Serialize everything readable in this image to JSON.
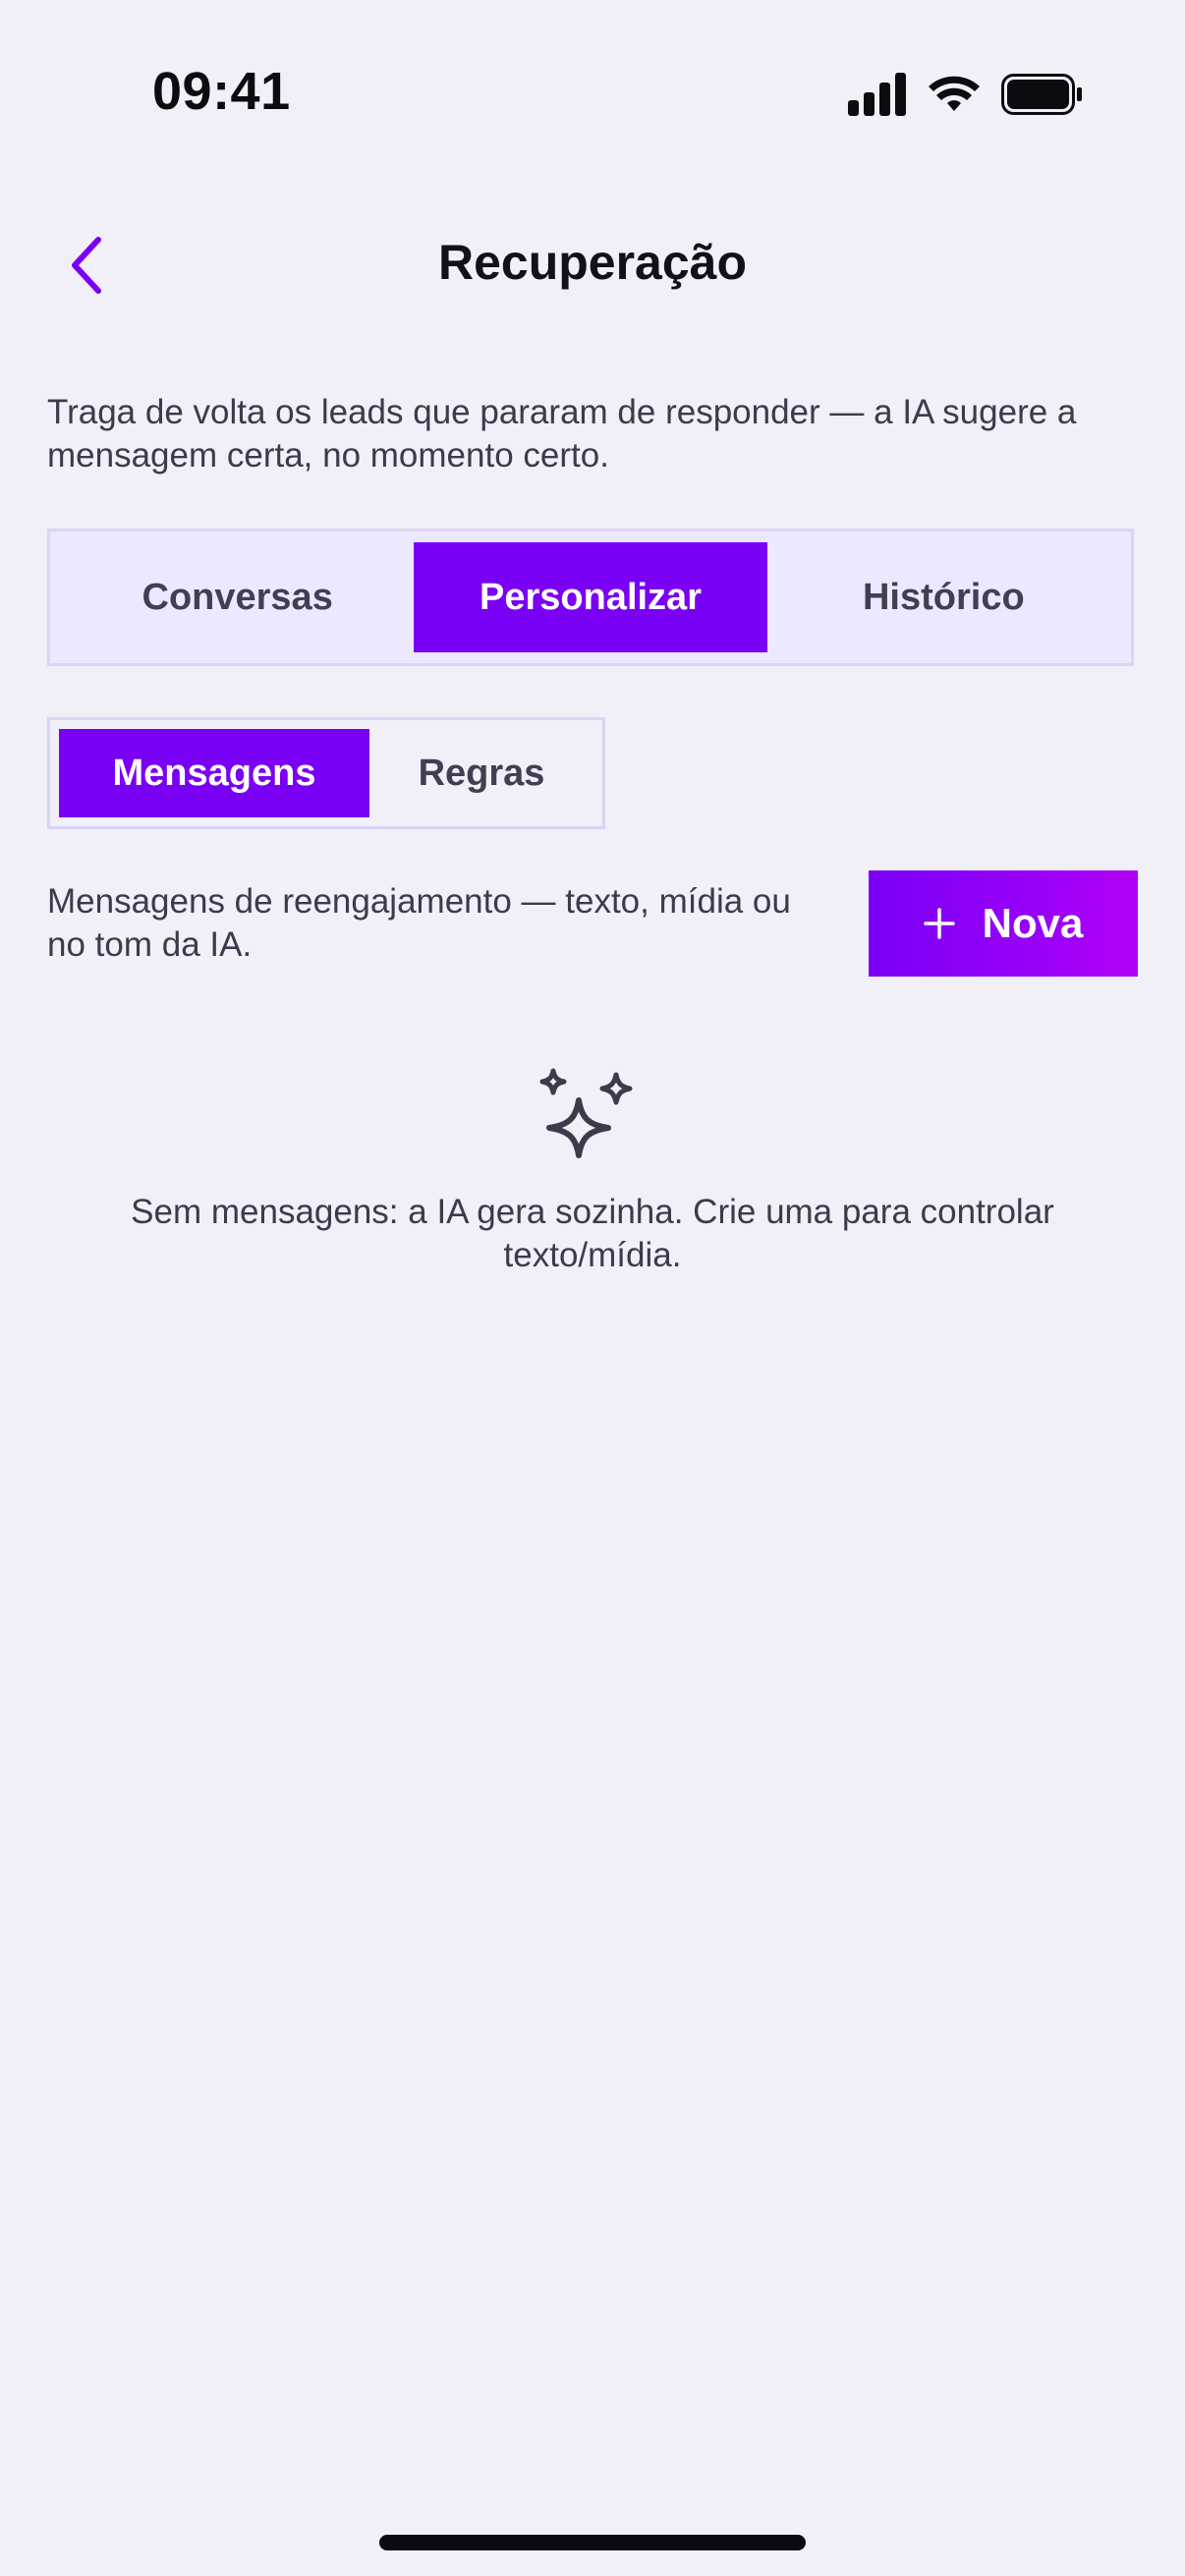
{
  "status_bar": {
    "time": "09:41"
  },
  "header": {
    "back_icon": "chevron-left-icon",
    "title": "Recuperação"
  },
  "description": "Traga de volta os leads que pararam de responder — a IA sugere a mensagem certa, no momento certo.",
  "main_tabs": [
    {
      "label": "Conversas",
      "active": false
    },
    {
      "label": "Personalizar",
      "active": true
    },
    {
      "label": "Histórico",
      "active": false
    }
  ],
  "sub_tabs": [
    {
      "label": "Mensagens",
      "active": true
    },
    {
      "label": "Regras",
      "active": false
    }
  ],
  "section": {
    "description": "Mensagens de reengajamento — texto, mídia ou no tom da IA.",
    "new_button_label": "Nova",
    "new_button_icon": "plus-icon"
  },
  "empty_state": {
    "icon": "sparkles-icon",
    "text": "Sem mensagens: a IA gera sozinha. Crie uma para controlar texto/mídia."
  },
  "colors": {
    "accent": "#7a00f5",
    "background": "#f1eff8",
    "tab_bar_bg": "#ece8fd",
    "border": "#d9d5f3",
    "text_secondary": "#3d3a4c"
  }
}
